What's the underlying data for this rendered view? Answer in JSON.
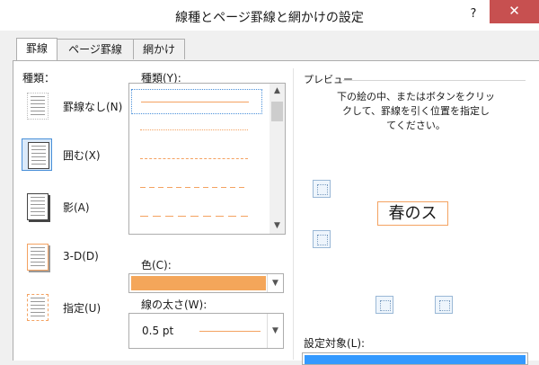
{
  "window": {
    "title": "線種とページ罫線と網かけの設定",
    "help": "?",
    "close": "✕"
  },
  "tabs": [
    "罫線",
    "ページ罫線",
    "網かけ"
  ],
  "settings": {
    "label": "種類：",
    "items": [
      {
        "label": "罫線なし(N)",
        "icon": "none-border-icon"
      },
      {
        "label": "囲む(X)",
        "icon": "box-border-icon"
      },
      {
        "label": "影(A)",
        "icon": "shadow-border-icon"
      },
      {
        "label": "3-D(D)",
        "icon": "3d-border-icon"
      },
      {
        "label": "指定(U)",
        "icon": "custom-border-icon"
      }
    ],
    "selected_index": 1
  },
  "style": {
    "label": "種類(Y):",
    "items": [
      "solid",
      "dotted",
      "dashed-short",
      "dashed-medium",
      "dashed-long"
    ],
    "selected_index": 0
  },
  "color": {
    "label": "色(C):",
    "value": "#f4a65a"
  },
  "width": {
    "label": "線の太さ(W):",
    "value": "0.5 pt"
  },
  "preview": {
    "label": "プレビュー",
    "instructions": [
      "下の絵の中、またはボタンをクリッ",
      "クして、罫線を引く位置を指定し",
      "てください。"
    ],
    "sample_text": "春のス"
  },
  "apply_to": {
    "label": "設定対象(L):",
    "value": ""
  },
  "colors": {
    "accent": "#f4a261",
    "selection": "#4a90d9",
    "close": "#c75050"
  }
}
